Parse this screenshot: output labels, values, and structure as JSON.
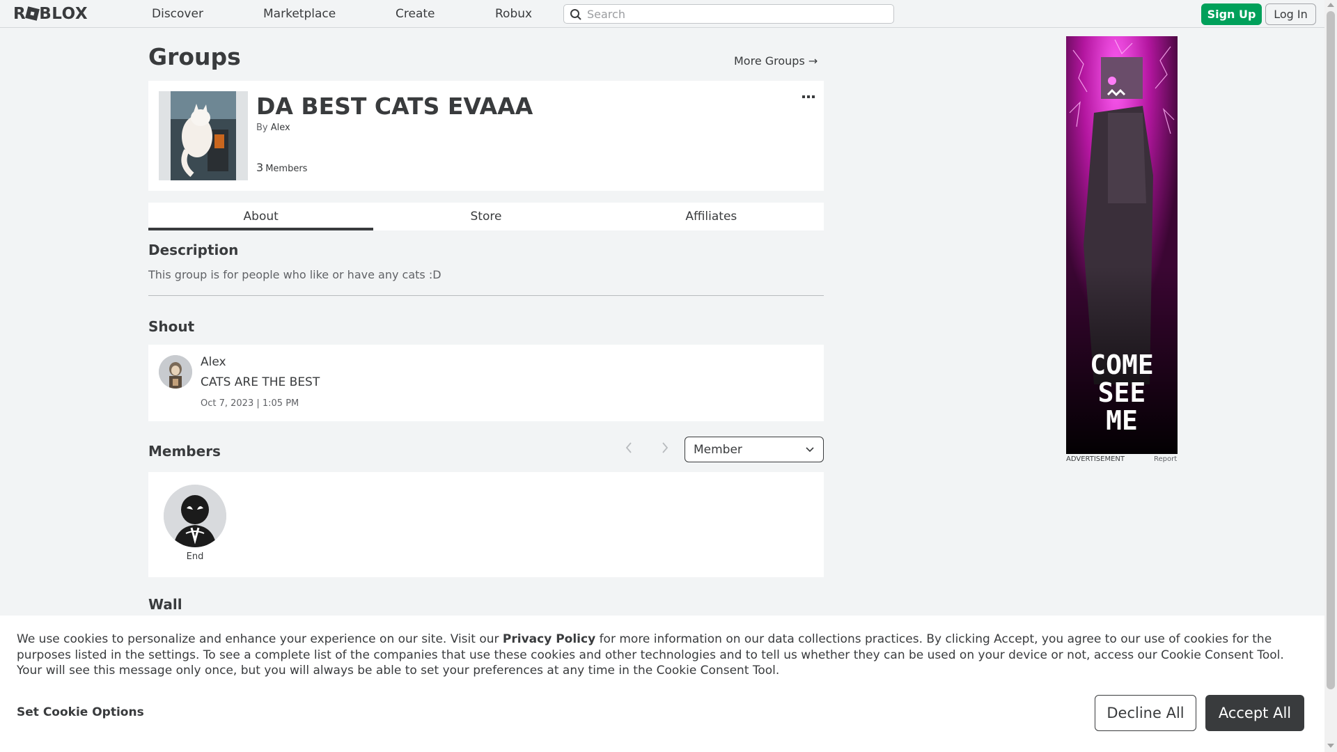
{
  "nav": {
    "logo": "ROBLOX",
    "links": [
      "Discover",
      "Marketplace",
      "Create",
      "Robux"
    ],
    "search_placeholder": "Search",
    "signup": "Sign Up",
    "login": "Log In"
  },
  "page": {
    "title": "Groups",
    "more_groups": "More Groups →"
  },
  "group": {
    "name": "DA BEST CATS EVAAA",
    "by_label": "By",
    "owner": "Alex",
    "member_count": "3",
    "member_label": "Members"
  },
  "tabs": [
    "About",
    "Store",
    "Affiliates"
  ],
  "description": {
    "title": "Description",
    "text": "This group is for people who like or have any cats :D"
  },
  "shout": {
    "title": "Shout",
    "user": "Alex",
    "text": "CATS ARE THE BEST",
    "date": "Oct 7, 2023 | 1:05 PM"
  },
  "members": {
    "title": "Members",
    "role_selected": "Member",
    "list": [
      {
        "name": "End"
      }
    ]
  },
  "wall": {
    "title": "Wall"
  },
  "ad": {
    "text_lines": [
      "COME",
      "SEE",
      "ME"
    ],
    "label": "ADVERTISEMENT",
    "report": "Report"
  },
  "cookie": {
    "text_before": "We use cookies to personalize and enhance your experience on our site. Visit our ",
    "privacy_link": "Privacy Policy",
    "text_after": " for more information on our data collections practices. By clicking Accept, you agree to our use of cookies for the purposes listed in the settings. To see a complete list of the companies that use these cookies and other technologies and to tell us whether they can be used on your device or not, access our Cookie Consent Tool. Your will see this message only once, but you will always be able to set your preferences at any time in the Cookie Consent Tool.",
    "set_options": "Set Cookie Options",
    "decline": "Decline All",
    "accept": "Accept All"
  },
  "colors": {
    "signup_green": "#00a05a",
    "accept_dark": "#393b3d",
    "ad_magenta": "#d81fd0"
  }
}
